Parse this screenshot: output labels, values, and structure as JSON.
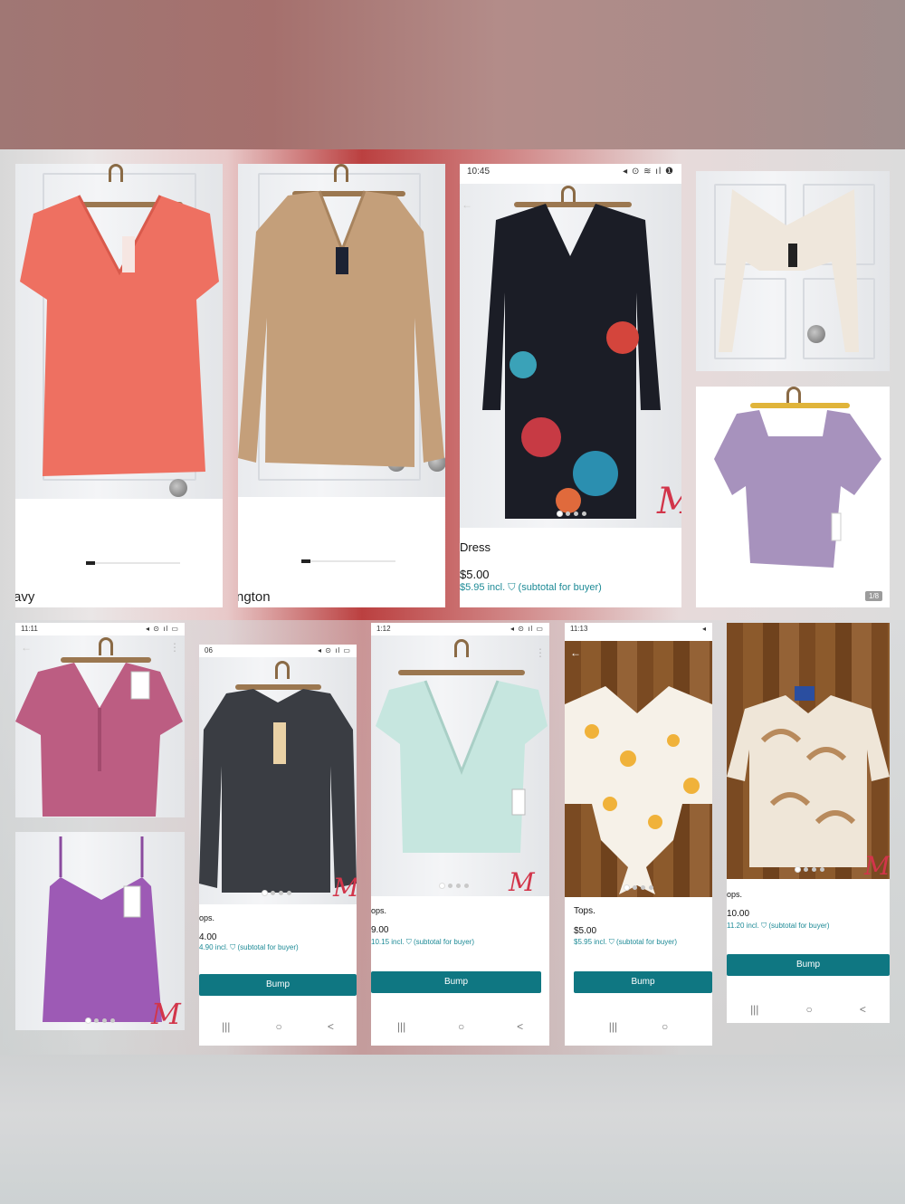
{
  "cards": {
    "oldnavy": {
      "caption": "avy"
    },
    "sweater": {
      "caption": "ngton"
    },
    "dress": {
      "time": "10:45",
      "status_icons": "◂ ⊙ ≋ ıl ❶",
      "title": "Dress",
      "price": "$5.00",
      "subtotal": "$5.95  incl.",
      "subtotal_note": "(subtotal for buyer)",
      "watermark": "M"
    },
    "purple_top": {
      "counter": "1/8"
    },
    "pink_crop": {
      "time": "11:11",
      "status_icons": "◂ ⊙ ıl ▭"
    },
    "camisole": {
      "watermark": "M"
    },
    "black_sweater": {
      "time": "06",
      "status_icons": "◂ ⊙ ıl ▭",
      "title": "ops.",
      "price": "4.00",
      "subtotal": "4.90  incl.",
      "subtotal_note": "(subtotal for buyer)",
      "bump": "Bump",
      "watermark": "M"
    },
    "mint_top": {
      "time": "1:12",
      "status_icons": "◂ ⊙ ıl ▭",
      "title": "ops.",
      "price": "9.00",
      "subtotal": "10.15  incl.",
      "subtotal_note": "(subtotal for buyer)",
      "bump": "Bump",
      "watermark": "M"
    },
    "floral_top": {
      "time": "11:13",
      "status_icons": "◂",
      "title": "Tops.",
      "price": "$5.00",
      "subtotal": "$5.95  incl.",
      "subtotal_note": "(subtotal for buyer)",
      "bump": "Bump"
    },
    "leaf_top": {
      "title": "ops.",
      "price": "10.00",
      "subtotal": "11.20  incl.",
      "subtotal_note": "(subtotal for buyer)",
      "bump": "Bump",
      "watermark": "M"
    }
  },
  "nav_icons": {
    "recents": "|||",
    "home": "○",
    "back": "<"
  },
  "icons": [
    "back-arrow-icon",
    "more-vertical-icon",
    "shield-check-icon",
    "recents-icon",
    "home-icon",
    "nav-back-icon"
  ],
  "colors": {
    "accent": "#0f7782",
    "link": "#1d8a96",
    "watermark": "#d2354a"
  }
}
